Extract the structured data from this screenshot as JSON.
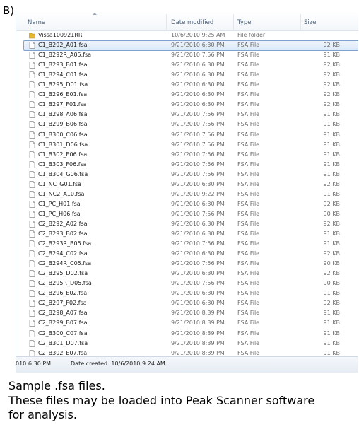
{
  "figure_label": "B)",
  "columns": {
    "name": "Name",
    "date_modified": "Date modified",
    "type": "Type",
    "size": "Size"
  },
  "files": [
    {
      "name": "Vissa100921RR",
      "date": "10/6/2010 9:25 AM",
      "type": "File folder",
      "size": "",
      "icon": "folder-icon",
      "selected": false
    },
    {
      "name": "C1_B292_A01.fsa",
      "date": "9/21/2010 6:30 PM",
      "type": "FSA File",
      "size": "92 KB",
      "icon": "file-icon",
      "selected": true
    },
    {
      "name": "C1_B292R_A05.fsa",
      "date": "9/21/2010 7:56 PM",
      "type": "FSA File",
      "size": "91 KB",
      "icon": "file-icon",
      "selected": false
    },
    {
      "name": "C1_B293_B01.fsa",
      "date": "9/21/2010 6:30 PM",
      "type": "FSA File",
      "size": "92 KB",
      "icon": "file-icon",
      "selected": false
    },
    {
      "name": "C1_B294_C01.fsa",
      "date": "9/21/2010 6:30 PM",
      "type": "FSA File",
      "size": "92 KB",
      "icon": "file-icon",
      "selected": false
    },
    {
      "name": "C1_B295_D01.fsa",
      "date": "9/21/2010 6:30 PM",
      "type": "FSA File",
      "size": "92 KB",
      "icon": "file-icon",
      "selected": false
    },
    {
      "name": "C1_B296_E01.fsa",
      "date": "9/21/2010 6:30 PM",
      "type": "FSA File",
      "size": "92 KB",
      "icon": "file-icon",
      "selected": false
    },
    {
      "name": "C1_B297_F01.fsa",
      "date": "9/21/2010 6:30 PM",
      "type": "FSA File",
      "size": "92 KB",
      "icon": "file-icon",
      "selected": false
    },
    {
      "name": "C1_B298_A06.fsa",
      "date": "9/21/2010 7:56 PM",
      "type": "FSA File",
      "size": "91 KB",
      "icon": "file-icon",
      "selected": false
    },
    {
      "name": "C1_B299_B06.fsa",
      "date": "9/21/2010 7:56 PM",
      "type": "FSA File",
      "size": "91 KB",
      "icon": "file-icon",
      "selected": false
    },
    {
      "name": "C1_B300_C06.fsa",
      "date": "9/21/2010 7:56 PM",
      "type": "FSA File",
      "size": "91 KB",
      "icon": "file-icon",
      "selected": false
    },
    {
      "name": "C1_B301_D06.fsa",
      "date": "9/21/2010 7:56 PM",
      "type": "FSA File",
      "size": "91 KB",
      "icon": "file-icon",
      "selected": false
    },
    {
      "name": "C1_B302_E06.fsa",
      "date": "9/21/2010 7:56 PM",
      "type": "FSA File",
      "size": "91 KB",
      "icon": "file-icon",
      "selected": false
    },
    {
      "name": "C1_B303_F06.fsa",
      "date": "9/21/2010 7:56 PM",
      "type": "FSA File",
      "size": "91 KB",
      "icon": "file-icon",
      "selected": false
    },
    {
      "name": "C1_B304_G06.fsa",
      "date": "9/21/2010 7:56 PM",
      "type": "FSA File",
      "size": "91 KB",
      "icon": "file-icon",
      "selected": false
    },
    {
      "name": "C1_NC_G01.fsa",
      "date": "9/21/2010 6:30 PM",
      "type": "FSA File",
      "size": "92 KB",
      "icon": "file-icon",
      "selected": false
    },
    {
      "name": "C1_NC2_A10.fsa",
      "date": "9/21/2010 9:22 PM",
      "type": "FSA File",
      "size": "91 KB",
      "icon": "file-icon",
      "selected": false
    },
    {
      "name": "C1_PC_H01.fsa",
      "date": "9/21/2010 6:30 PM",
      "type": "FSA File",
      "size": "92 KB",
      "icon": "file-icon",
      "selected": false
    },
    {
      "name": "C1_PC_H06.fsa",
      "date": "9/21/2010 7:56 PM",
      "type": "FSA File",
      "size": "90 KB",
      "icon": "file-icon",
      "selected": false
    },
    {
      "name": "C2_B292_A02.fsa",
      "date": "9/21/2010 6:30 PM",
      "type": "FSA File",
      "size": "92 KB",
      "icon": "file-icon",
      "selected": false
    },
    {
      "name": "C2_B293_B02.fsa",
      "date": "9/21/2010 6:30 PM",
      "type": "FSA File",
      "size": "91 KB",
      "icon": "file-icon",
      "selected": false
    },
    {
      "name": "C2_B293R_B05.fsa",
      "date": "9/21/2010 7:56 PM",
      "type": "FSA File",
      "size": "91 KB",
      "icon": "file-icon",
      "selected": false
    },
    {
      "name": "C2_B294_C02.fsa",
      "date": "9/21/2010 6:30 PM",
      "type": "FSA File",
      "size": "92 KB",
      "icon": "file-icon",
      "selected": false
    },
    {
      "name": "C2_B294R_C05.fsa",
      "date": "9/21/2010 7:56 PM",
      "type": "FSA File",
      "size": "90 KB",
      "icon": "file-icon",
      "selected": false
    },
    {
      "name": "C2_B295_D02.fsa",
      "date": "9/21/2010 6:30 PM",
      "type": "FSA File",
      "size": "92 KB",
      "icon": "file-icon",
      "selected": false
    },
    {
      "name": "C2_B295R_D05.fsa",
      "date": "9/21/2010 7:56 PM",
      "type": "FSA File",
      "size": "90 KB",
      "icon": "file-icon",
      "selected": false
    },
    {
      "name": "C2_B296_E02.fsa",
      "date": "9/21/2010 6:30 PM",
      "type": "FSA File",
      "size": "91 KB",
      "icon": "file-icon",
      "selected": false
    },
    {
      "name": "C2_B297_F02.fsa",
      "date": "9/21/2010 6:30 PM",
      "type": "FSA File",
      "size": "92 KB",
      "icon": "file-icon",
      "selected": false
    },
    {
      "name": "C2_B298_A07.fsa",
      "date": "9/21/2010 8:39 PM",
      "type": "FSA File",
      "size": "91 KB",
      "icon": "file-icon",
      "selected": false
    },
    {
      "name": "C2_B299_B07.fsa",
      "date": "9/21/2010 8:39 PM",
      "type": "FSA File",
      "size": "91 KB",
      "icon": "file-icon",
      "selected": false
    },
    {
      "name": "C2_B300_C07.fsa",
      "date": "9/21/2010 8:39 PM",
      "type": "FSA File",
      "size": "91 KB",
      "icon": "file-icon",
      "selected": false
    },
    {
      "name": "C2_B301_D07.fsa",
      "date": "9/21/2010 8:39 PM",
      "type": "FSA File",
      "size": "91 KB",
      "icon": "file-icon",
      "selected": false
    },
    {
      "name": "C2_B302_E07.fsa",
      "date": "9/21/2010 8:39 PM",
      "type": "FSA File",
      "size": "91 KB",
      "icon": "file-icon",
      "selected": false
    }
  ],
  "status": {
    "modified": "010 6:30 PM",
    "date_created": "Date created: 10/6/2010 9:24 AM"
  },
  "caption": {
    "line1": "Sample .fsa files.",
    "line2": "These files may be loaded into Peak Scanner software",
    "line3": "for analysis."
  },
  "colors": {
    "selection_border": "#7da2ce",
    "selection_fill": "#dce9f8",
    "folder": "#e8b73a",
    "header_text": "#4c607a"
  }
}
